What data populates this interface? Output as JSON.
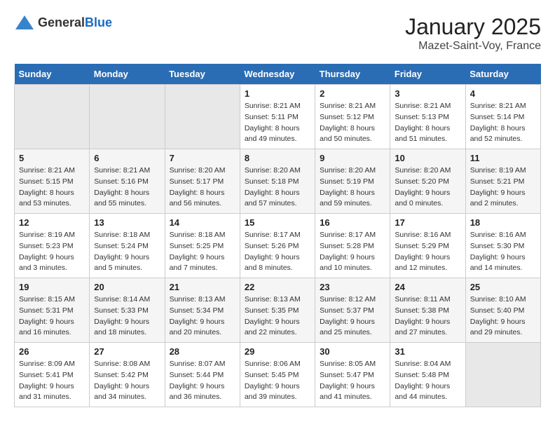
{
  "logo": {
    "general": "General",
    "blue": "Blue"
  },
  "header": {
    "month": "January 2025",
    "location": "Mazet-Saint-Voy, France"
  },
  "weekdays": [
    "Sunday",
    "Monday",
    "Tuesday",
    "Wednesday",
    "Thursday",
    "Friday",
    "Saturday"
  ],
  "weeks": [
    [
      {
        "day": "",
        "sunrise": "",
        "sunset": "",
        "daylight": ""
      },
      {
        "day": "",
        "sunrise": "",
        "sunset": "",
        "daylight": ""
      },
      {
        "day": "",
        "sunrise": "",
        "sunset": "",
        "daylight": ""
      },
      {
        "day": "1",
        "sunrise": "Sunrise: 8:21 AM",
        "sunset": "Sunset: 5:11 PM",
        "daylight": "Daylight: 8 hours and 49 minutes."
      },
      {
        "day": "2",
        "sunrise": "Sunrise: 8:21 AM",
        "sunset": "Sunset: 5:12 PM",
        "daylight": "Daylight: 8 hours and 50 minutes."
      },
      {
        "day": "3",
        "sunrise": "Sunrise: 8:21 AM",
        "sunset": "Sunset: 5:13 PM",
        "daylight": "Daylight: 8 hours and 51 minutes."
      },
      {
        "day": "4",
        "sunrise": "Sunrise: 8:21 AM",
        "sunset": "Sunset: 5:14 PM",
        "daylight": "Daylight: 8 hours and 52 minutes."
      }
    ],
    [
      {
        "day": "5",
        "sunrise": "Sunrise: 8:21 AM",
        "sunset": "Sunset: 5:15 PM",
        "daylight": "Daylight: 8 hours and 53 minutes."
      },
      {
        "day": "6",
        "sunrise": "Sunrise: 8:21 AM",
        "sunset": "Sunset: 5:16 PM",
        "daylight": "Daylight: 8 hours and 55 minutes."
      },
      {
        "day": "7",
        "sunrise": "Sunrise: 8:20 AM",
        "sunset": "Sunset: 5:17 PM",
        "daylight": "Daylight: 8 hours and 56 minutes."
      },
      {
        "day": "8",
        "sunrise": "Sunrise: 8:20 AM",
        "sunset": "Sunset: 5:18 PM",
        "daylight": "Daylight: 8 hours and 57 minutes."
      },
      {
        "day": "9",
        "sunrise": "Sunrise: 8:20 AM",
        "sunset": "Sunset: 5:19 PM",
        "daylight": "Daylight: 8 hours and 59 minutes."
      },
      {
        "day": "10",
        "sunrise": "Sunrise: 8:20 AM",
        "sunset": "Sunset: 5:20 PM",
        "daylight": "Daylight: 9 hours and 0 minutes."
      },
      {
        "day": "11",
        "sunrise": "Sunrise: 8:19 AM",
        "sunset": "Sunset: 5:21 PM",
        "daylight": "Daylight: 9 hours and 2 minutes."
      }
    ],
    [
      {
        "day": "12",
        "sunrise": "Sunrise: 8:19 AM",
        "sunset": "Sunset: 5:23 PM",
        "daylight": "Daylight: 9 hours and 3 minutes."
      },
      {
        "day": "13",
        "sunrise": "Sunrise: 8:18 AM",
        "sunset": "Sunset: 5:24 PM",
        "daylight": "Daylight: 9 hours and 5 minutes."
      },
      {
        "day": "14",
        "sunrise": "Sunrise: 8:18 AM",
        "sunset": "Sunset: 5:25 PM",
        "daylight": "Daylight: 9 hours and 7 minutes."
      },
      {
        "day": "15",
        "sunrise": "Sunrise: 8:17 AM",
        "sunset": "Sunset: 5:26 PM",
        "daylight": "Daylight: 9 hours and 8 minutes."
      },
      {
        "day": "16",
        "sunrise": "Sunrise: 8:17 AM",
        "sunset": "Sunset: 5:28 PM",
        "daylight": "Daylight: 9 hours and 10 minutes."
      },
      {
        "day": "17",
        "sunrise": "Sunrise: 8:16 AM",
        "sunset": "Sunset: 5:29 PM",
        "daylight": "Daylight: 9 hours and 12 minutes."
      },
      {
        "day": "18",
        "sunrise": "Sunrise: 8:16 AM",
        "sunset": "Sunset: 5:30 PM",
        "daylight": "Daylight: 9 hours and 14 minutes."
      }
    ],
    [
      {
        "day": "19",
        "sunrise": "Sunrise: 8:15 AM",
        "sunset": "Sunset: 5:31 PM",
        "daylight": "Daylight: 9 hours and 16 minutes."
      },
      {
        "day": "20",
        "sunrise": "Sunrise: 8:14 AM",
        "sunset": "Sunset: 5:33 PM",
        "daylight": "Daylight: 9 hours and 18 minutes."
      },
      {
        "day": "21",
        "sunrise": "Sunrise: 8:13 AM",
        "sunset": "Sunset: 5:34 PM",
        "daylight": "Daylight: 9 hours and 20 minutes."
      },
      {
        "day": "22",
        "sunrise": "Sunrise: 8:13 AM",
        "sunset": "Sunset: 5:35 PM",
        "daylight": "Daylight: 9 hours and 22 minutes."
      },
      {
        "day": "23",
        "sunrise": "Sunrise: 8:12 AM",
        "sunset": "Sunset: 5:37 PM",
        "daylight": "Daylight: 9 hours and 25 minutes."
      },
      {
        "day": "24",
        "sunrise": "Sunrise: 8:11 AM",
        "sunset": "Sunset: 5:38 PM",
        "daylight": "Daylight: 9 hours and 27 minutes."
      },
      {
        "day": "25",
        "sunrise": "Sunrise: 8:10 AM",
        "sunset": "Sunset: 5:40 PM",
        "daylight": "Daylight: 9 hours and 29 minutes."
      }
    ],
    [
      {
        "day": "26",
        "sunrise": "Sunrise: 8:09 AM",
        "sunset": "Sunset: 5:41 PM",
        "daylight": "Daylight: 9 hours and 31 minutes."
      },
      {
        "day": "27",
        "sunrise": "Sunrise: 8:08 AM",
        "sunset": "Sunset: 5:42 PM",
        "daylight": "Daylight: 9 hours and 34 minutes."
      },
      {
        "day": "28",
        "sunrise": "Sunrise: 8:07 AM",
        "sunset": "Sunset: 5:44 PM",
        "daylight": "Daylight: 9 hours and 36 minutes."
      },
      {
        "day": "29",
        "sunrise": "Sunrise: 8:06 AM",
        "sunset": "Sunset: 5:45 PM",
        "daylight": "Daylight: 9 hours and 39 minutes."
      },
      {
        "day": "30",
        "sunrise": "Sunrise: 8:05 AM",
        "sunset": "Sunset: 5:47 PM",
        "daylight": "Daylight: 9 hours and 41 minutes."
      },
      {
        "day": "31",
        "sunrise": "Sunrise: 8:04 AM",
        "sunset": "Sunset: 5:48 PM",
        "daylight": "Daylight: 9 hours and 44 minutes."
      },
      {
        "day": "",
        "sunrise": "",
        "sunset": "",
        "daylight": ""
      }
    ]
  ]
}
